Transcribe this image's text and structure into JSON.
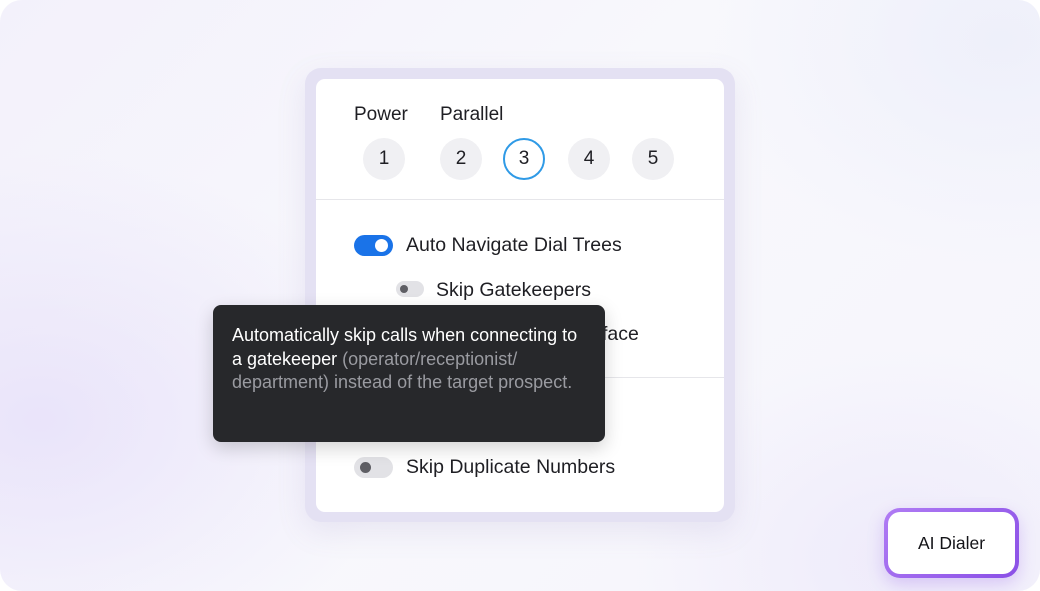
{
  "dialer_modes": {
    "power_label": "Power",
    "parallel_label": "Parallel",
    "options": [
      "1",
      "2",
      "3",
      "4",
      "5"
    ],
    "selected": "3"
  },
  "settings": {
    "auto_navigate": {
      "label": "Auto Navigate Dial Trees",
      "enabled": true
    },
    "skip_gatekeepers": {
      "label": "Skip Gatekeepers",
      "enabled": false
    },
    "partially_hidden_suffix": "face",
    "skip_duplicates": {
      "label": "Skip Duplicate Numbers",
      "enabled": false
    }
  },
  "tooltip": {
    "primary_text": "Automatically skip calls when connecting to a gatekeeper",
    "secondary_text": "(operator/receptionist/ department) instead of the target prospect."
  },
  "badge": {
    "label": "AI Dialer"
  },
  "colors": {
    "toggle_on": "#1a73e8",
    "selected_ring": "#2f9ae6",
    "tooltip_bg": "#27282b",
    "badge_gradient": "#9b63ee"
  }
}
